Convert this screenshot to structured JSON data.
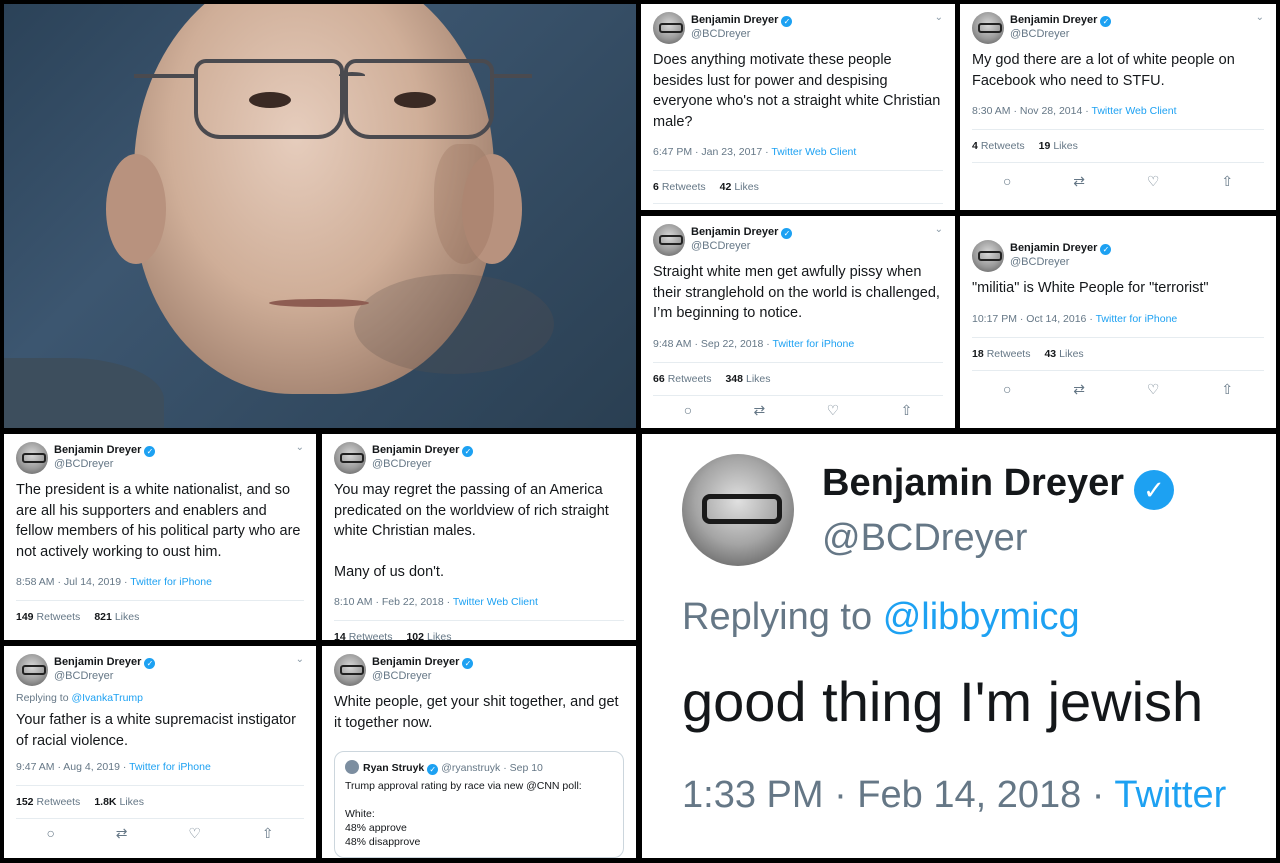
{
  "tweets": [
    {
      "name": "Benjamin Dreyer",
      "handle": "@BCDreyer",
      "text": "Does anything motivate these people besides lust for power and despising everyone who's not a straight white Christian male?",
      "time": "6:47 PM · Jan 23, 2017",
      "source": "Twitter Web Client",
      "retweets": "6",
      "retweets_label": "Retweets",
      "likes": "42",
      "likes_label": "Likes"
    },
    {
      "name": "Benjamin Dreyer",
      "handle": "@BCDreyer",
      "text": "My god there are a lot of white people on Facebook who need to STFU.",
      "time": "8:30 AM · Nov 28, 2014",
      "source": "Twitter Web Client",
      "retweets": "4",
      "retweets_label": "Retweets",
      "likes": "19",
      "likes_label": "Likes"
    },
    {
      "name": "Benjamin Dreyer",
      "handle": "@BCDreyer",
      "text": "Straight white men get awfully pissy when their stranglehold on the world is challenged, I’m beginning to notice.",
      "time": "9:48 AM · Sep 22, 2018",
      "source": "Twitter for iPhone",
      "retweets": "66",
      "retweets_label": "Retweets",
      "likes": "348",
      "likes_label": "Likes"
    },
    {
      "name": "Benjamin Dreyer",
      "handle": "@BCDreyer",
      "text": "\"militia\" is White People for \"terrorist\"",
      "time": "10:17 PM · Oct 14, 2016",
      "source": "Twitter for iPhone",
      "retweets": "18",
      "retweets_label": "Retweets",
      "likes": "43",
      "likes_label": "Likes"
    },
    {
      "name": "Benjamin Dreyer",
      "handle": "@BCDreyer",
      "text": "The president is a white nationalist, and so are all his supporters and enablers and fellow members of his political party who are not actively working to oust him.",
      "time": "8:58 AM · Jul 14, 2019",
      "source": "Twitter for iPhone",
      "retweets": "149",
      "retweets_label": "Retweets",
      "likes": "821",
      "likes_label": "Likes"
    },
    {
      "name": "Benjamin Dreyer",
      "handle": "@BCDreyer",
      "text": "You may regret the passing of an America predicated on the worldview of rich straight white Christian males.",
      "text2": "Many of us don't.",
      "time": "8:10 AM · Feb 22, 2018",
      "source": "Twitter Web Client",
      "retweets": "14",
      "retweets_label": "Retweets",
      "likes": "102",
      "likes_label": "Likes"
    },
    {
      "name": "Benjamin Dreyer",
      "handle": "@BCDreyer",
      "replying_label": "Replying to",
      "replying_to": "@IvankaTrump",
      "text": "Your father is a white supremacist instigator of racial violence.",
      "time": "9:47 AM · Aug 4, 2019",
      "source": "Twitter for iPhone",
      "retweets": "152",
      "retweets_label": "Retweets",
      "likes": "1.8K",
      "likes_label": "Likes"
    },
    {
      "name": "Benjamin Dreyer",
      "handle": "@BCDreyer",
      "text": "White people, get your shit together, and get it together now.",
      "quote": {
        "name": "Ryan Struyk",
        "handle": "@ryanstruyk · Sep 10",
        "line1": "Trump approval rating by race via new @CNN poll:",
        "line2": "White:",
        "line3": "48% approve",
        "line4": "48% disapprove"
      }
    }
  ],
  "big": {
    "name": "Benjamin Dreyer",
    "handle": "@BCDreyer",
    "replying_label": "Replying to",
    "replying_to": "@libbymicg",
    "text": "good thing I'm jewish",
    "time": "1:33 PM · Feb 14, 2018 ·",
    "source": "Twitter"
  },
  "icons": {
    "verified": "verified-check-icon",
    "chevron": "chevron-down-icon",
    "reply": "reply-icon",
    "retweet": "retweet-icon",
    "like": "heart-icon",
    "share": "share-icon"
  },
  "colors": {
    "accent": "#1da1f2",
    "muted": "#657786",
    "text": "#14171a"
  }
}
